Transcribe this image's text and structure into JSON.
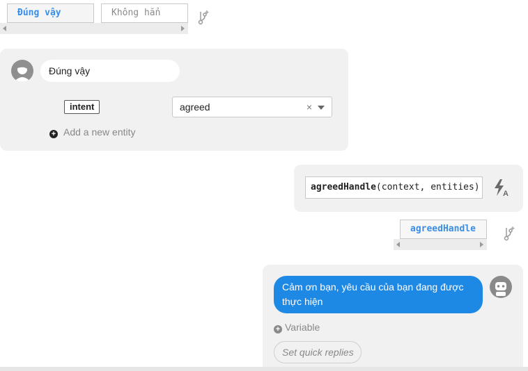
{
  "top_variants": {
    "active_label": "Đúng vậy",
    "inactive_label": "Không hẳn"
  },
  "user_message": {
    "text": "Đúng vậy",
    "entity_name": "intent",
    "entity_value": "agreed",
    "clear_symbol": "×",
    "add_entity_label": "Add a new entity"
  },
  "handler": {
    "function_name": "agreedHandle",
    "args": "(context, entities)",
    "icon": "lightning-a-icon"
  },
  "handler_variant": {
    "label": "agreedHandle"
  },
  "bot_message": {
    "text": "Cảm ơn bạn, yêu cầu của bạn đang được thực hiện",
    "variable_label": "Variable",
    "quick_replies_placeholder": "Set quick replies"
  },
  "colors": {
    "accent": "#1e88e5",
    "chip_active_text": "#3a8ee6",
    "panel_bg": "#f1f1f1"
  }
}
